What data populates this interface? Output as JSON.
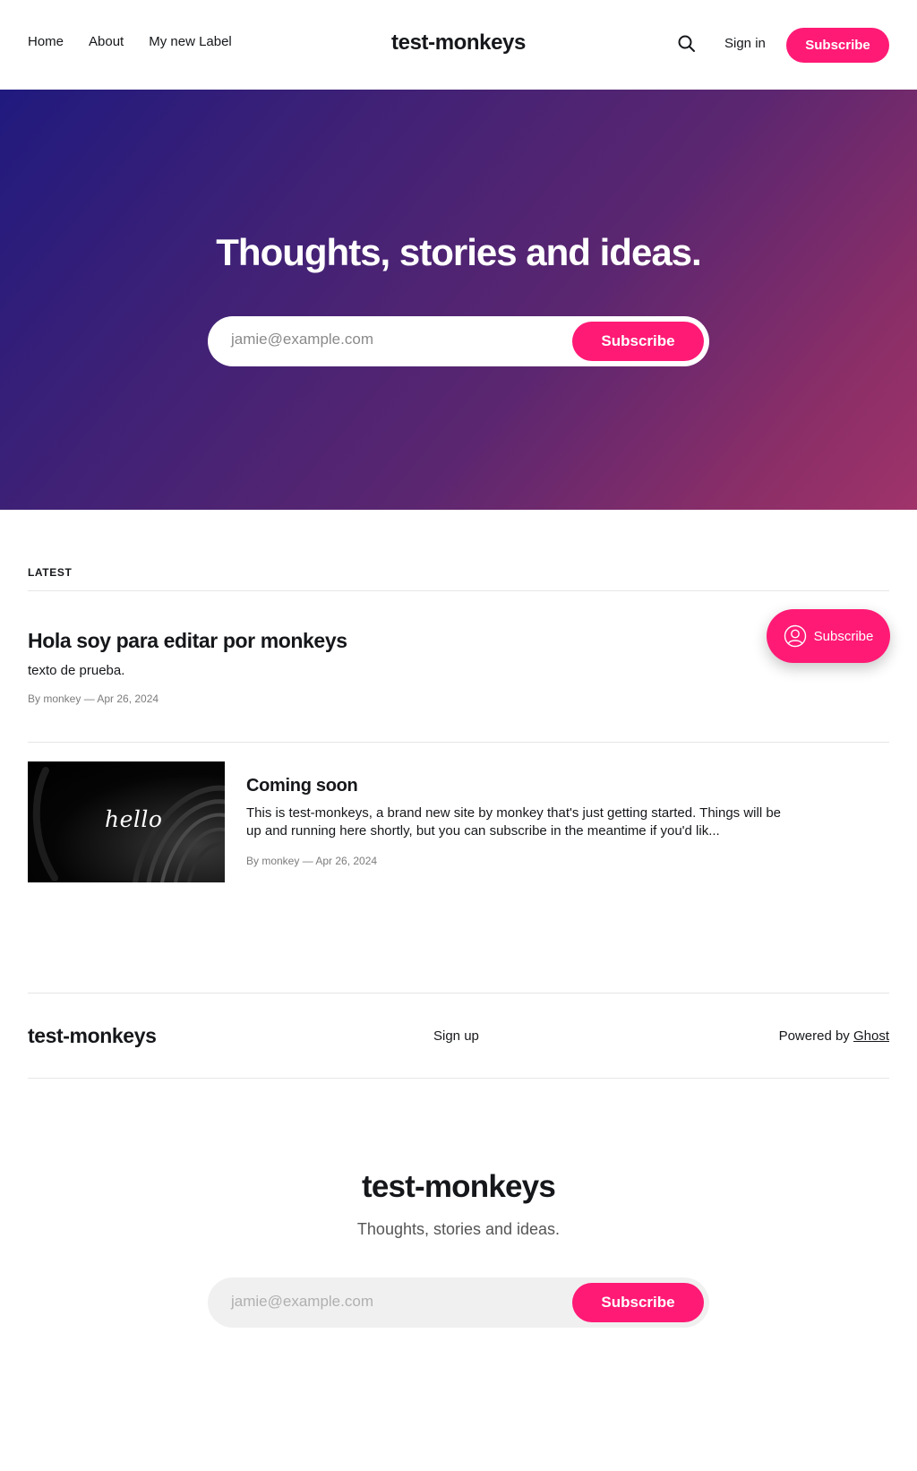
{
  "header": {
    "nav": [
      "Home",
      "About",
      "My new Label"
    ],
    "logo": "test-monkeys",
    "search_icon": "search-icon",
    "signin_label": "Sign in",
    "subscribe_label": "Subscribe"
  },
  "hero": {
    "title": "Thoughts, stories and ideas.",
    "email_placeholder": "jamie@example.com",
    "subscribe_label": "Subscribe"
  },
  "latest": {
    "label": "LATEST",
    "posts": [
      {
        "title": "Hola soy para editar por monkeys",
        "excerpt": "texto de prueba.",
        "meta": "By monkey — Apr 26, 2024"
      },
      {
        "title": "Coming soon",
        "image_text": "hello",
        "excerpt": "This is test-monkeys, a brand new site by monkey that's just getting started. Things will be up and running here shortly, but you can subscribe in the meantime if you'd lik...",
        "meta": "By monkey — Apr 26, 2024"
      }
    ]
  },
  "portal": {
    "label": "Subscribe",
    "icon": "user-circle-icon"
  },
  "footer": {
    "logo": "test-monkeys",
    "signup_label": "Sign up",
    "powered_prefix": "Powered by",
    "powered_link": "Ghost"
  },
  "cta": {
    "title": "test-monkeys",
    "description": "Thoughts, stories and ideas.",
    "email_placeholder": "jamie@example.com",
    "subscribe_label": "Subscribe"
  },
  "colors": {
    "accent": "#ff1a75",
    "text": "#15171a",
    "hero_gradient_start": "#201a7e",
    "hero_gradient_end": "#a0336a"
  }
}
